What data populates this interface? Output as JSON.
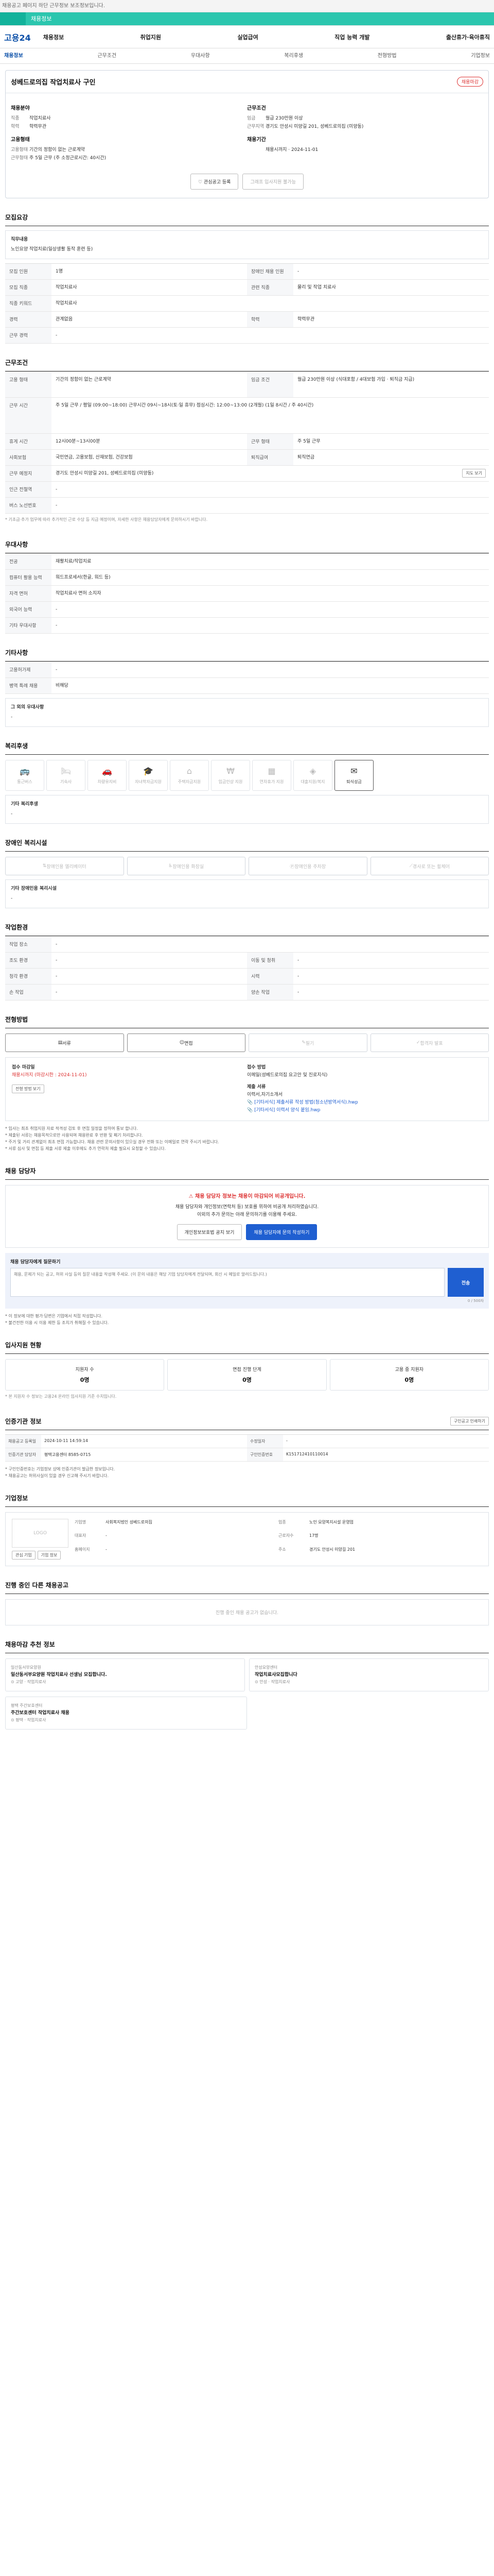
{
  "topbar": "채용공고 페이지 하단 근무정보 보조정보입니다.",
  "greenbar": "채용정보",
  "header": {
    "logo": "고용24",
    "gnb": [
      "채용정보",
      "취업지원",
      "실업급여",
      "직업 능력 개발",
      "출산휴가·육아휴직"
    ]
  },
  "subnav": [
    "채용정보",
    "근무조건",
    "우대사항",
    "복리후생",
    "전형방법",
    "기업정보"
  ],
  "card": {
    "company": "성베드로의집 작업치료사 구인",
    "tag": "채용마감",
    "left_title": "채용분야",
    "left": [
      {
        "k": "직종",
        "v": "작업치료사"
      },
      {
        "k": "학력",
        "v": "학력무관"
      }
    ],
    "left2_title": "고용형태",
    "left2": [
      {
        "k": "고용형태",
        "v": "기간의 정함이 없는 근로계약"
      },
      {
        "k": "근무형태",
        "v": "주 5일 근무 (주 소정근로시간: 40시간)"
      }
    ],
    "right_title": "근무조건",
    "right": [
      {
        "k": "임금",
        "v": "월급 230만원 이상"
      },
      {
        "k": "근무지역",
        "v": "경기도 안성시 미양길 201, 성베드로의집 (미양동)"
      }
    ],
    "right2_title": "채용기간",
    "right2": [
      {
        "k": "",
        "v": "채용시까지 · 2024-11-01"
      }
    ],
    "btn_scrap": "관심공고 등록",
    "btn_apply": "그래프 입사지원 불가능"
  },
  "req": {
    "title": "모집요강",
    "job_title": "직무내용",
    "job_desc": "노인요양 작업치료(일상생활 동작 훈련 등)",
    "rows": [
      {
        "k": "모집 인원",
        "v": "1명",
        "k2": "장애인 채용 인원",
        "v2": "-"
      },
      {
        "k": "모집 직종",
        "v": "작업치료사",
        "k2": "관련 직종",
        "v2": "물리 및 작업 치료사"
      },
      {
        "k": "직종 키워드",
        "v": "작업치료사",
        "k2": "",
        "v2": ""
      },
      {
        "k": "경력",
        "v": "관계없음",
        "k2": "학력",
        "v2": "학력무관"
      },
      {
        "k": "근무 경력",
        "v": "-",
        "k2": "",
        "v2": ""
      }
    ]
  },
  "cond": {
    "title": "근무조건",
    "rows": [
      {
        "k": "고용 형태",
        "v": "기간의 정함이 없는 근로계약",
        "k2": "임금 조건",
        "v2": "월급 230만원 이상 (식대포함 / 4대보험 가입 · 퇴직금 지급)"
      },
      {
        "k": "근무 시간",
        "v": "주 5일 근무 / 평일 (09:00~18:00) 근무시간 09시~18시(토·일 휴무) 점심시간: 12:00~13:00 (2개월) (1일 8시간 / 주 40시간)",
        "k2": "",
        "v2": ""
      },
      {
        "k": "휴게 시간",
        "v": "12시00분~13시00분",
        "k2": "근무 형태",
        "v2": "주 5일 근무"
      },
      {
        "k": "사회보험",
        "v": "국민연금, 고용보험, 산재보험, 건강보험",
        "k2": "퇴직급여",
        "v2": "퇴직연금"
      },
      {
        "k": "근무 예정지",
        "v": "경기도 안성시 미양길 201, 성베드로의집 (미양동)",
        "k2": "",
        "v2": ""
      },
      {
        "k": "인근 전철역",
        "v": "-",
        "k2": "",
        "v2": ""
      },
      {
        "k": "버스 노선번호",
        "v": "-",
        "k2": "",
        "v2": ""
      }
    ],
    "map_btn": "지도 보기",
    "note": "* 기초급·추가 업무에 따라 추가적인 근로 수당 등 지급 예정이며, 자세한 사항은 채용담당자에게 문의하시기 바랍니다."
  },
  "pref": {
    "title": "우대사항",
    "rows": [
      {
        "k": "전공",
        "v": "재활치료/작업치료"
      },
      {
        "k": "컴퓨터 활용 능력",
        "v": "워드프로세서(한글, 워드 등)"
      },
      {
        "k": "자격 면허",
        "v": "작업치료사 면허 소지자"
      },
      {
        "k": "외국어 능력",
        "v": "-"
      },
      {
        "k": "기타 우대사항",
        "v": "-"
      }
    ]
  },
  "etc": {
    "title": "기타사항",
    "rows": [
      {
        "k": "고용허가제",
        "v": "-"
      },
      {
        "k": "병역 특례 채용",
        "v": "비해당"
      }
    ],
    "other_title": "그 외의 우대사항",
    "other_val": "-"
  },
  "welfare": {
    "title": "복리후생",
    "items": [
      "통근버스",
      "기숙사",
      "차량유지비",
      "자녀학자금지원",
      "주택자금지원",
      "임금인상 지원",
      "연차휴가 지원",
      "대출지원/복지",
      "퇴식성금"
    ],
    "other_label": "기타 복리후생",
    "other_val": "-"
  },
  "disab": {
    "title": "장애인 복리시설",
    "items": [
      "장애인용 엘리베이터",
      "장애인용 화장실",
      "장애인용 주차장",
      "경사로 또는 휠체어"
    ],
    "other_label": "기타 장애인용 복리시설",
    "other_val": "-"
  },
  "env": {
    "title": "작업환경",
    "rows": [
      {
        "k": "작업 장소",
        "v": "-",
        "k2": "",
        "v2": ""
      },
      {
        "k": "조도 환경",
        "v": "-",
        "k2": "이동 및 청취",
        "v2": "-"
      },
      {
        "k": "청각 환경",
        "v": "-",
        "k2": "시력",
        "v2": "-"
      },
      {
        "k": "손 작업",
        "v": "-",
        "k2": "양손 작업",
        "v2": "-"
      }
    ]
  },
  "process": {
    "title": "전형방법",
    "steps": [
      "서류",
      "면접",
      "필기",
      "합격자 발표"
    ],
    "doc_title1": "접수 마감일",
    "doc_val1": "채용시까지 (마감시한 : 2024-11-01)",
    "doc_btn": "전형 방법 보기",
    "doc_title2": "접수 방법",
    "doc_val2": "이메일(성베드로의집 요고안 및 진로지식)",
    "doc_title3": "제출 서류",
    "doc_val3": "이력서,자기소개서",
    "files": [
      "[기타서식] 제출서류 작성 방법(청소년방역서식).hwp",
      "[기타서식] 이력서 양식 붙임.hwp"
    ],
    "bullets": [
      "* 입사는 최초 취업지원 자료 적격성 검토 후 면접 일정을 정하여 통보 합니다.",
      "* 제출된 서류는 채용목적으로만 사용되며 채용완료 후 반환 및 폐기 처리합니다.",
      "* 주거 및 거리 관계없이 최초 면접 가능합니다. 채용 관련 문의사항이 있으실 경우 전화 또는 이메일로 연락 주시기 바랍니다.",
      "* 서류 심사 및 면접 등 제출 서류 제출 이후에도 추가 연락처 제출 필요시 요청할 수 있습니다."
    ]
  },
  "contact": {
    "title": "채용 담당자",
    "warn_title": "채용 담당자 정보는 채용이 마감되어 비공개입니다.",
    "warn_lines": [
      "채용 담당자와 개인정보(연락처 등) 보호를 위하여 비공개 처리하였습니다.",
      "이외의 추가 문의는 아래 문의하기를 이용해 주세요."
    ],
    "btn_call": "개인정보보호법 공지 보기",
    "btn_inq": "채용 담당자에 문의 작성하기",
    "ask_label": "채용 담당자에게 질문하기",
    "ask_placeholder": "채용, 문제가 되는 공고, 허위 사실 등의 질문 내용을 작성해 주세요. (이 문의 내용은 해당 기업 담당자에게 전달되며, 회신 시 메일로 알려드립니다.)",
    "ask_btn": "전송",
    "ask_count": "0 / 500자",
    "bullets": [
      "* 이 정보에 대한 평가·답변은 기업에서 직접 작성합니다.",
      "* 불건전한 이용 시 이용 제한 등 조치가 취해질 수 있습니다."
    ]
  },
  "status": {
    "title": "입사지원 현황",
    "items": [
      {
        "label": "지원자 수",
        "n": "0명"
      },
      {
        "label": "면접 진행 단계",
        "n": "0명"
      },
      {
        "label": "고용 중 지원자",
        "n": "0명"
      }
    ],
    "note": "* 본 지원자 수 정보는 고용24 온라인 입사지원 기준 수치입니다."
  },
  "meta": {
    "title": "인증기관 정보",
    "print_btn": "구인공고 인쇄하기",
    "rows": [
      {
        "k": "채용공고 등록일",
        "v": "2024-10-11 14:59:14",
        "k2": "수정일자",
        "v2": "-"
      },
      {
        "k": "인증기관 담당자",
        "v": "평택고용센터 8585-0715",
        "k2": "구인인증번호",
        "v2": "K151712410110014"
      }
    ],
    "notes": [
      "* 구인인증번호는 기업정보 상에 인증기관이 발급한 정보입니다.",
      "* 채용공고는 허위사실이 있을 경우 신고해 주시기 바랍니다."
    ]
  },
  "corp": {
    "title": "기업정보",
    "logo_alt": "LOGO",
    "btn_a": "관심 기업",
    "btn_b": "기업 정보",
    "details": [
      {
        "k": "기업명",
        "v": "사회복지법인 성베드로의집"
      },
      {
        "k": "업종",
        "v": "노인 요양복지시설 운영업"
      },
      {
        "k": "대표자",
        "v": "-"
      },
      {
        "k": "근로자수",
        "v": "17명"
      },
      {
        "k": "홈페이지",
        "v": "-"
      },
      {
        "k": "주소",
        "v": "경기도 안성시 미양길 201"
      }
    ]
  },
  "other": {
    "title": "진행 중인 다른 채용공고",
    "empty": "진행 중인 채용 공고가 없습니다."
  },
  "recommend": {
    "title": "채용마감 추천 정보",
    "items": [
      {
        "name": "일산동서부요양원 작업치료사 선생님 모집합니다.",
        "org": "일산동서부요양원",
        "meta1": "고양",
        "meta2": "작업치료사"
      },
      {
        "name": "작업치료사모집합니다",
        "org": "안성요양센터",
        "meta1": "안성",
        "meta2": "작업치료사"
      },
      {
        "name": "주간보호센터 작업치료사 채용",
        "org": "평택 주간보호센터",
        "meta1": "평택",
        "meta2": "작업치료사"
      }
    ]
  }
}
